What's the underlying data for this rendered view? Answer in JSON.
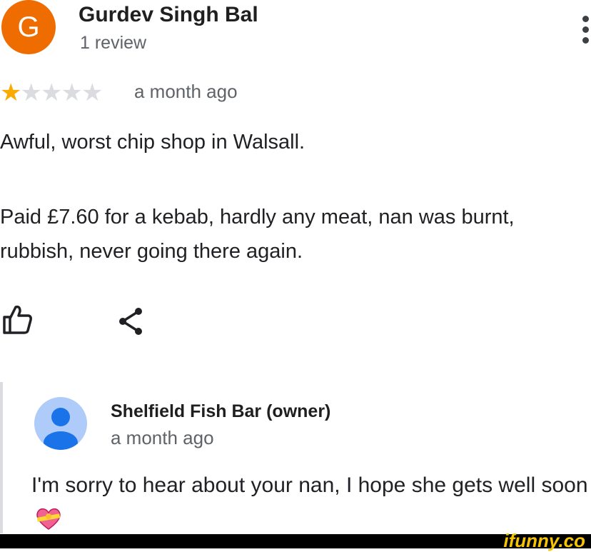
{
  "review": {
    "avatar_letter": "G",
    "avatar_color": "#ef6c00",
    "author": "Gurdev Singh Bal",
    "author_meta": "1 review",
    "rating": 1,
    "rating_max": 5,
    "date": "a month ago",
    "paragraph1": "Awful, worst chip shop in Walsall.",
    "paragraph2": "Paid £7.60 for a kebab, hardly any meat, nan was burnt, rubbish, never going there again.",
    "more_icon": "more-vert-icon",
    "like_icon": "thumbs-up-icon",
    "share_icon": "share-icon"
  },
  "reply": {
    "owner": "Shelfield Fish Bar (owner)",
    "date": "a month ago",
    "text": "I'm sorry to hear about your nan, I hope she gets well soon",
    "emoji": "heart-with-ribbon-emoji",
    "avatar_icon": "person-avatar-icon"
  },
  "watermark": "ifunny.co",
  "colors": {
    "star_on": "#f9ab00",
    "star_off": "#dadce0",
    "accent_avatar": "#aecbfa",
    "watermark": "#f6c400"
  }
}
